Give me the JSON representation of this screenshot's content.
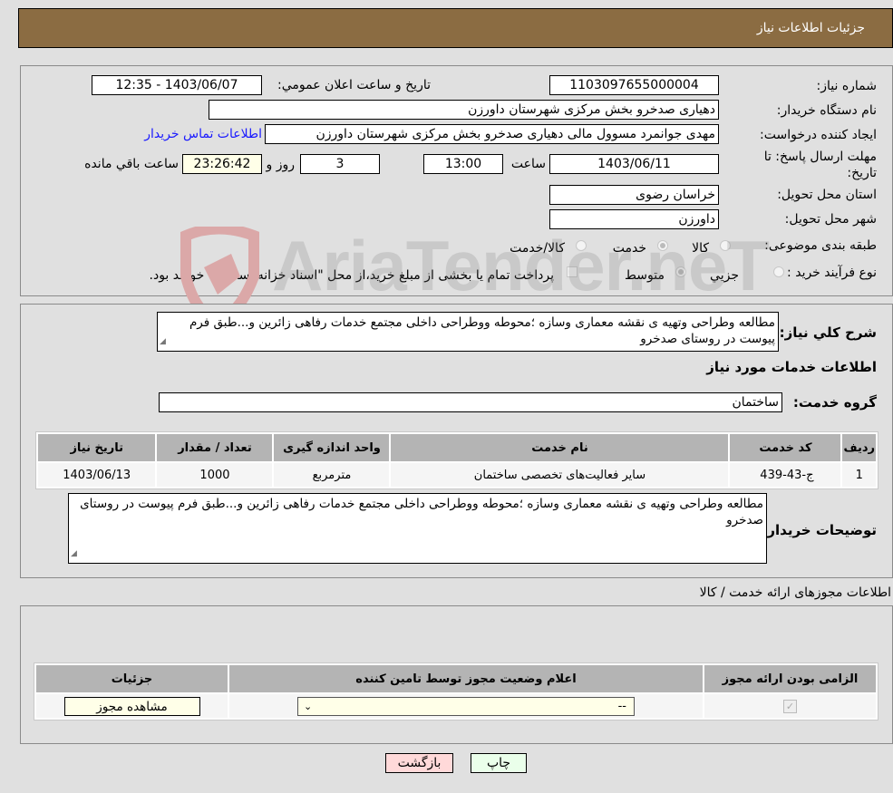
{
  "header": {
    "title": "جزئیات اطلاعات نیاز"
  },
  "form": {
    "need_number_label": "شماره نیاز:",
    "need_number": "1103097655000004",
    "announce_label": "تاریخ و ساعت اعلان عمومي:",
    "announce_value": "1403/06/07 - 12:35",
    "buyer_org_label": "نام دستگاه خریدار:",
    "buyer_org": "دهیاری صدخرو بخش مرکزی شهرستان داورزن",
    "creator_label": "ایجاد کننده درخواست:",
    "creator": "مهدی جوانمرد مسوول مالی دهیاری صدخرو بخش مرکزی شهرستان داورزن",
    "contact_link": "اطلاعات تماس خریدار",
    "deadline_label": "مهلت ارسال پاسخ: تا تاریخ:",
    "deadline_date": "1403/06/11",
    "time_label": "ساعت",
    "deadline_time": "13:00",
    "days": "3",
    "days_suffix": "روز و",
    "remaining": "23:26:42",
    "remaining_suffix": "ساعت باقي مانده",
    "province_label": "استان محل تحویل:",
    "province": "خراسان رضوی",
    "city_label": "شهر محل تحویل:",
    "city": "داورزن",
    "category_label": "طبقه بندی موضوعی:",
    "category_options": [
      {
        "label": "کالا",
        "checked": false
      },
      {
        "label": "خدمت",
        "checked": true
      },
      {
        "label": "کالا/خدمت",
        "checked": false
      }
    ],
    "process_label": "نوع فرآیند خرید :",
    "process_options": [
      {
        "label": "جزيي",
        "checked": false
      },
      {
        "label": "متوسط",
        "checked": true
      }
    ],
    "treasury_text": "پرداخت تمام یا بخشی از مبلغ خرید،از محل \"اسناد خزانه اسلامی\" خواهد بود.",
    "treasury_checked": false
  },
  "description": {
    "label": "شرح کلي نیاز:",
    "text": "مطالعه وطراحی وتهیه ی نقشه معماری وسازه ؛محوطه ووطراحی داخلی مجتمع خدمات رفاهی زائرین و...طبق فرم پیوست در روستای صدخرو"
  },
  "services": {
    "section_title": "اطلاعات خدمات مورد نیاز",
    "group_label": "گروه خدمت:",
    "group_value": "ساختمان",
    "columns": [
      "ردیف",
      "کد خدمت",
      "نام خدمت",
      "واحد اندازه گیری",
      "تعداد / مقدار",
      "تاریخ نیاز"
    ],
    "rows": [
      [
        "1",
        "ج-43-439",
        "سایر فعالیت‌های تخصصی ساختمان",
        "مترمربع",
        "1000",
        "1403/06/13"
      ]
    ],
    "buyer_notes_label": "توضیحات خریدار:",
    "buyer_notes": "مطالعه وطراحی وتهیه ی نقشه معماری وسازه ؛محوطه ووطراحی داخلی مجتمع خدمات رفاهی زائرین و...طبق فرم پیوست در روستای صدخرو"
  },
  "permits": {
    "section_title": "اطلاعات مجوزهای ارائه خدمت / کالا",
    "columns": [
      "الزامی بودن ارائه مجوز",
      "اعلام وضعیت مجوز توسط تامین کننده",
      "جزئیات"
    ],
    "required_checked": true,
    "status_selected": "--",
    "view_button": "مشاهده مجوز"
  },
  "actions": {
    "print": "چاپ",
    "back": "بازگشت"
  },
  "watermark": {
    "text": "AriaTender.neT"
  }
}
